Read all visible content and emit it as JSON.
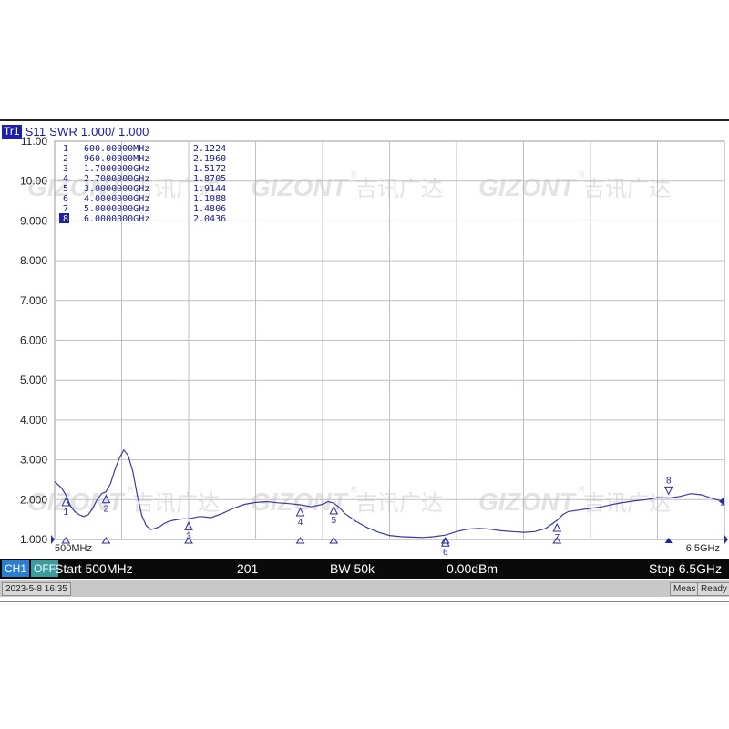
{
  "trace": {
    "id": "Tr1",
    "label": "S11  SWR  1.000/  1.000"
  },
  "x_axis": {
    "start_label": "500MHz",
    "stop_label": "6.5GHz"
  },
  "watermark": {
    "brand": "GIZONT",
    "chinese": "吉讯广达",
    "registered": "R"
  },
  "marker_table": [
    {
      "num": "1",
      "freq": "600.00000MHz",
      "value": "2.1224"
    },
    {
      "num": "2",
      "freq": "960.00000MHz",
      "value": "2.1960"
    },
    {
      "num": "3",
      "freq": "1.7000000GHz",
      "value": "1.5172"
    },
    {
      "num": "4",
      "freq": "2.7000000GHz",
      "value": "1.8705"
    },
    {
      "num": "5",
      "freq": "3.0000000GHz",
      "value": "1.9144"
    },
    {
      "num": "6",
      "freq": "4.0000000GHz",
      "value": "1.1088"
    },
    {
      "num": "7",
      "freq": "5.0000000GHz",
      "value": "1.4806"
    },
    {
      "num": "8",
      "freq": "6.0000000GHz",
      "value": "2.0436"
    }
  ],
  "status_bar": {
    "ch": "CH1",
    "off": "OFF",
    "start": "Start 500MHz",
    "points": "201",
    "bw": "BW 50k",
    "power": "0.00dBm",
    "stop": "Stop 6.5GHz"
  },
  "footer": {
    "datetime": "2023-5-8 16:35",
    "meas": "Meas",
    "ready": "Ready"
  },
  "colors": {
    "trace": "#3a3aa0",
    "grid": "#bfbfbf",
    "marker": "#2b2b99",
    "active_marker_fill": "#1f1fa8"
  },
  "chart_data": {
    "type": "line",
    "title": "S11 SWR",
    "xlabel": "",
    "ylabel": "",
    "xlim": [
      500,
      6500
    ],
    "ylim": [
      1.0,
      11.0
    ],
    "x_unit": "MHz",
    "yticks": [
      "11.00",
      "10.00",
      "9.000",
      "8.000",
      "7.000",
      "6.000",
      "5.000",
      "4.000",
      "3.000",
      "2.000",
      "1.000"
    ],
    "grid": true,
    "reference_marker": "1",
    "series": [
      {
        "x": [
          500,
          560,
          600,
          640,
          680,
          720,
          760,
          800,
          840,
          880,
          920,
          960,
          1000,
          1040,
          1080,
          1120,
          1160,
          1200,
          1240,
          1280,
          1320,
          1360,
          1400,
          1440,
          1480,
          1520,
          1560,
          1600,
          1650,
          1700,
          1800,
          1900,
          2000,
          2100,
          2200,
          2300,
          2400,
          2500,
          2600,
          2700,
          2800,
          2900,
          2950,
          3000,
          3050,
          3100,
          3200,
          3300,
          3400,
          3500,
          3600,
          3700,
          3800,
          3900,
          4000,
          4100,
          4200,
          4300,
          4400,
          4500,
          4600,
          4700,
          4800,
          4900,
          5000,
          5050,
          5100,
          5200,
          5300,
          5400,
          5500,
          5600,
          5700,
          5800,
          5900,
          6000,
          6100,
          6200,
          6300,
          6400,
          6500
        ],
        "y": [
          2.45,
          2.3,
          2.12,
          1.85,
          1.7,
          1.62,
          1.58,
          1.62,
          1.78,
          2.0,
          2.15,
          2.2,
          2.4,
          2.75,
          3.05,
          3.25,
          3.1,
          2.7,
          2.1,
          1.6,
          1.35,
          1.25,
          1.28,
          1.32,
          1.4,
          1.45,
          1.48,
          1.5,
          1.52,
          1.52,
          1.58,
          1.55,
          1.65,
          1.78,
          1.88,
          1.93,
          1.95,
          1.92,
          1.9,
          1.87,
          1.82,
          1.88,
          1.95,
          1.91,
          1.8,
          1.65,
          1.45,
          1.3,
          1.18,
          1.1,
          1.07,
          1.06,
          1.05,
          1.07,
          1.11,
          1.2,
          1.26,
          1.28,
          1.26,
          1.22,
          1.2,
          1.18,
          1.2,
          1.28,
          1.48,
          1.62,
          1.7,
          1.74,
          1.78,
          1.82,
          1.88,
          1.93,
          1.97,
          2.0,
          2.05,
          2.04,
          2.08,
          2.15,
          2.12,
          2.02,
          1.95
        ]
      }
    ],
    "markers": [
      {
        "num": "1",
        "x": 600,
        "y": 2.1224
      },
      {
        "num": "2",
        "x": 960,
        "y": 2.196
      },
      {
        "num": "3",
        "x": 1700,
        "y": 1.5172
      },
      {
        "num": "4",
        "x": 2700,
        "y": 1.8705
      },
      {
        "num": "5",
        "x": 3000,
        "y": 1.9144
      },
      {
        "num": "6",
        "x": 4000,
        "y": 1.1088
      },
      {
        "num": "7",
        "x": 5000,
        "y": 1.4806
      },
      {
        "num": "8",
        "x": 6000,
        "y": 2.0436
      }
    ],
    "active_marker": "8"
  }
}
